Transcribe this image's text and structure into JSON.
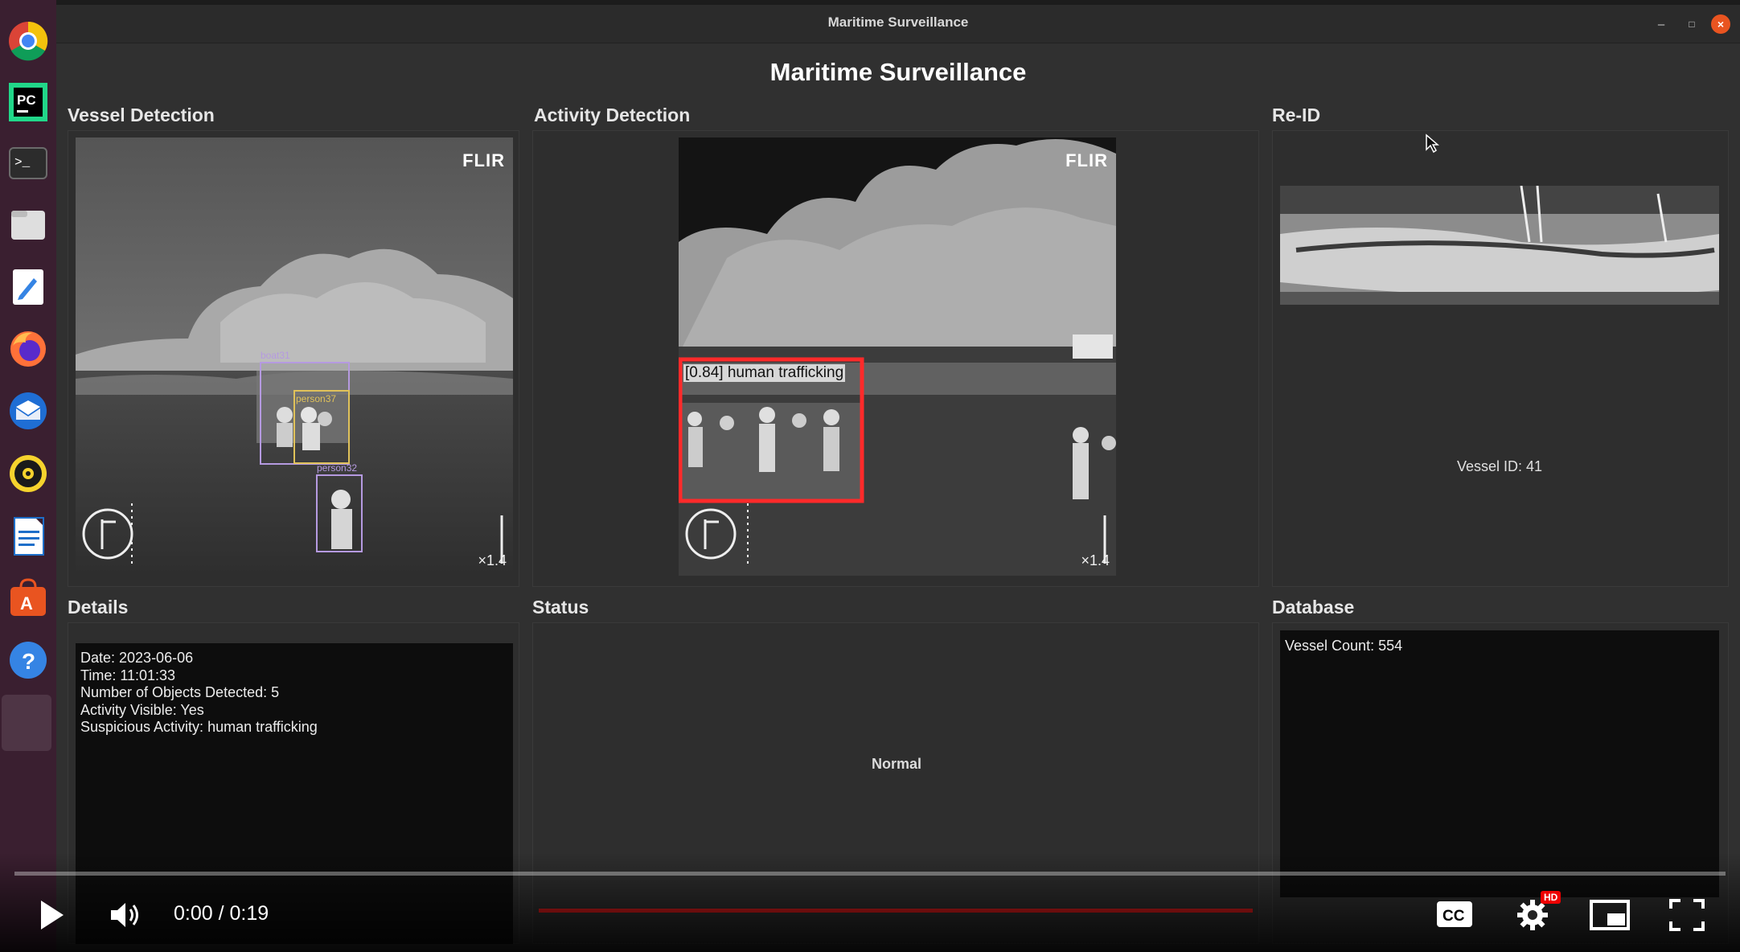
{
  "window": {
    "title": "Maritime Surveillance",
    "controls": [
      "–",
      "□",
      "×"
    ]
  },
  "app": {
    "title": "Maritime Surveillance"
  },
  "sections": {
    "vessel_detection": "Vessel Detection",
    "activity_detection": "Activity Detection",
    "reid": "Re-ID",
    "details": "Details",
    "status": "Status",
    "database": "Database"
  },
  "vessel_feed": {
    "brand": "FLIR",
    "zoom": "×1.4",
    "detections": [
      {
        "label": "boat31",
        "color": "#b59ae0"
      },
      {
        "label": "person37",
        "color": "#e0c25a"
      },
      {
        "label": "person32",
        "color": "#b59ae0"
      }
    ]
  },
  "activity_feed": {
    "brand": "FLIR",
    "zoom": "×1.4",
    "alert_label": "[0.84] human trafficking",
    "alert_color": "#ff2a2a"
  },
  "reid": {
    "vessel_id": "Vessel ID: 41"
  },
  "details": {
    "lines": [
      "Date: 2023-06-06",
      "Time: 11:01:33",
      "Number of Objects Detected: 5",
      "Activity Visible: Yes",
      "Suspicious Activity: human trafficking"
    ]
  },
  "status": {
    "text": "Normal",
    "indicator_color": "#d81b1b"
  },
  "database": {
    "vessel_count": "Vessel Count: 554"
  },
  "player": {
    "time": "0:00 / 0:19",
    "progress": 0.0,
    "hd_badge": "HD",
    "accent_color": "#ff0000"
  },
  "dock": {
    "items": [
      "chrome-icon",
      "pycharm-icon",
      "terminal-icon",
      "files-icon",
      "text-editor-icon",
      "firefox-icon",
      "thunderbird-icon",
      "rhythmbox-icon",
      "writer-icon",
      "app-center-icon",
      "help-icon"
    ],
    "pycharm_label": "PC"
  }
}
